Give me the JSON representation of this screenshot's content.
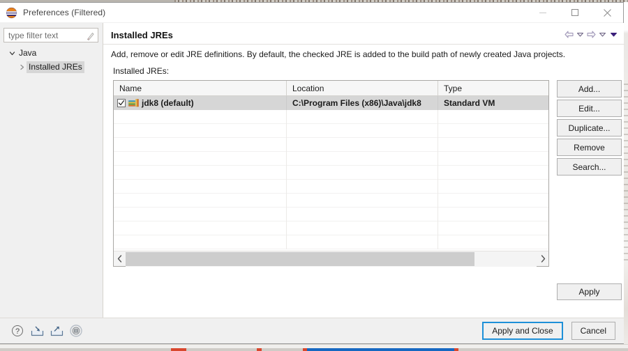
{
  "window": {
    "title": "Preferences (Filtered)",
    "app_icon": "eclipse-logo-icon",
    "controls": {
      "minimize": "minimize-icon",
      "maximize": "maximize-icon",
      "close": "close-icon"
    }
  },
  "sidebar": {
    "filter": {
      "placeholder": "type filter text",
      "value": "",
      "icon": "clear-filter-icon"
    },
    "tree": [
      {
        "label": "Java",
        "expanded": true,
        "selected": false,
        "depth": 0,
        "twisty": "chevron-down-icon"
      },
      {
        "label": "Installed JREs",
        "expanded": false,
        "selected": true,
        "depth": 1,
        "twisty": "chevron-right-icon"
      }
    ]
  },
  "page": {
    "title": "Installed JREs",
    "description": "Add, remove or edit JRE definitions. By default, the checked JRE is added to the build path of newly created Java projects.",
    "table_label": "Installed JREs:",
    "nav": [
      {
        "name": "back-arrow-icon",
        "glyph": "back"
      },
      {
        "name": "back-dropdown-icon",
        "glyph": "caret"
      },
      {
        "name": "forward-arrow-icon",
        "glyph": "forward"
      },
      {
        "name": "forward-dropdown-icon",
        "glyph": "caret"
      },
      {
        "name": "menu-dropdown-icon",
        "glyph": "caret-filled"
      }
    ]
  },
  "table": {
    "columns": [
      "Name",
      "Location",
      "Type"
    ],
    "rows": [
      {
        "checked": true,
        "icon": "jre-library-icon",
        "name": "jdk8 (default)",
        "location": "C:\\Program Files (x86)\\Java\\jdk8",
        "type": "Standard VM",
        "selected": true
      }
    ],
    "empty_row_count": 10,
    "scrollbar": {
      "left_arrow": "chevron-left-icon",
      "right_arrow": "chevron-right-icon"
    }
  },
  "side_buttons": [
    {
      "label": "Add..."
    },
    {
      "label": "Edit..."
    },
    {
      "label": "Duplicate..."
    },
    {
      "label": "Remove"
    },
    {
      "label": "Search..."
    }
  ],
  "apply_button": {
    "label": "Apply"
  },
  "footer": {
    "icons": [
      {
        "name": "help-icon"
      },
      {
        "name": "import-preferences-icon"
      },
      {
        "name": "export-preferences-icon"
      },
      {
        "name": "recorder-icon"
      }
    ],
    "buttons": [
      {
        "label": "Apply and Close",
        "focused": true
      },
      {
        "label": "Cancel",
        "focused": false
      }
    ]
  },
  "colors": {
    "accent_focus": "#1e90d8",
    "selection": "#d6d6d6",
    "dialog_bg": "#f0f0f0",
    "content_bg": "#ffffff",
    "dropdown_purple": "#3b1f7a"
  }
}
